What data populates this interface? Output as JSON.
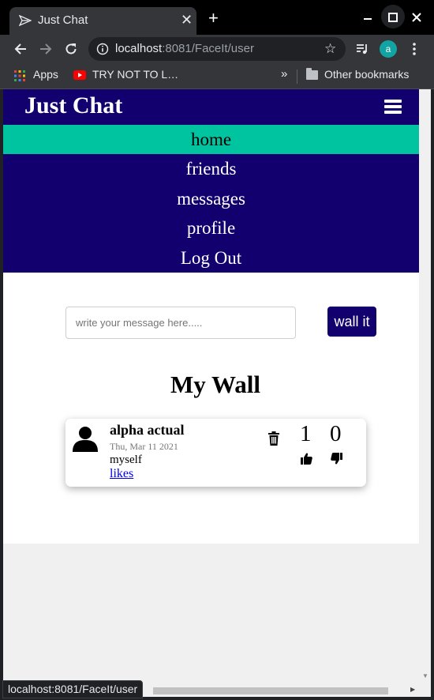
{
  "browser": {
    "tab_title": "Just Chat",
    "tab_close": "✕",
    "new_tab": "+",
    "url_host": "localhost",
    "url_rest": ":8081/FaceIt/user",
    "profile_initial": "a",
    "bookmarks": {
      "apps_label": "Apps",
      "youtube_label": "TRY NOT TO L…",
      "overflow": "»",
      "other_label": "Other bookmarks"
    },
    "status_url": "localhost:8081/FaceIt/user"
  },
  "site": {
    "brand": "Just Chat",
    "menu": [
      {
        "label": "home",
        "active": true
      },
      {
        "label": "friends",
        "active": false
      },
      {
        "label": "messages",
        "active": false
      },
      {
        "label": "profile",
        "active": false
      },
      {
        "label": "Log Out",
        "active": false
      }
    ]
  },
  "composer": {
    "placeholder": "write your message here.....",
    "value": "",
    "button_label": "wall it"
  },
  "wall": {
    "title": "My Wall",
    "posts": [
      {
        "author": "alpha actual",
        "date": "Thu, Mar 11 2021",
        "body": "myself",
        "likes_link": "likes",
        "like_count": "1",
        "dislike_count": "0"
      }
    ]
  },
  "colors": {
    "nav_bg": "#12006f",
    "active_menu": "#00c4a0",
    "link": "#0000ee"
  },
  "icons": {
    "tab": "send-icon",
    "menu": "hamburger-icon",
    "avatar": "user-icon",
    "delete": "trash-icon",
    "like": "thumbs-up-icon",
    "dislike": "thumbs-down-icon"
  }
}
